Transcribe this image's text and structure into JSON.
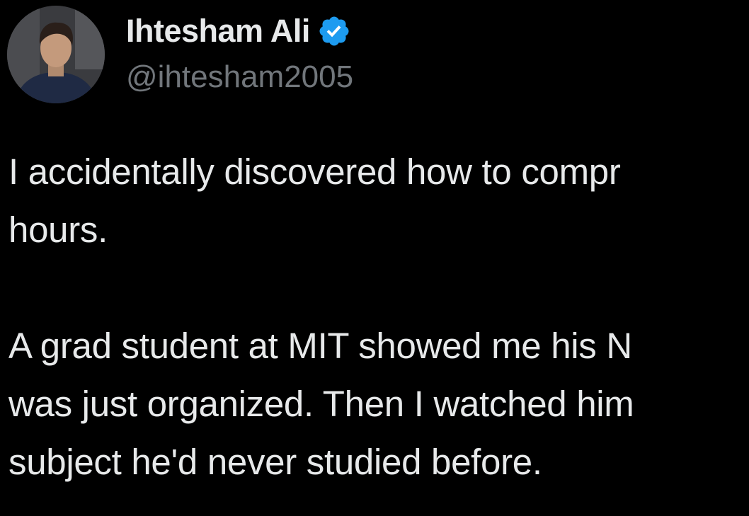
{
  "author": {
    "display_name": "Ihtesham Ali",
    "handle": "@ihtesham2005",
    "verified": true,
    "avatar_icon": "profile-photo"
  },
  "colors": {
    "background": "#000000",
    "text_primary": "#e7e9ea",
    "text_secondary": "#71767b",
    "verified_badge": "#1d9bf0"
  },
  "tweet": {
    "paragraph_1": [
      "I accidentally discovered how to compr",
      "hours."
    ],
    "paragraph_2": [
      "A grad student at MIT showed me his N",
      "was just organized. Then I watched him",
      "subject he'd never studied before."
    ]
  }
}
